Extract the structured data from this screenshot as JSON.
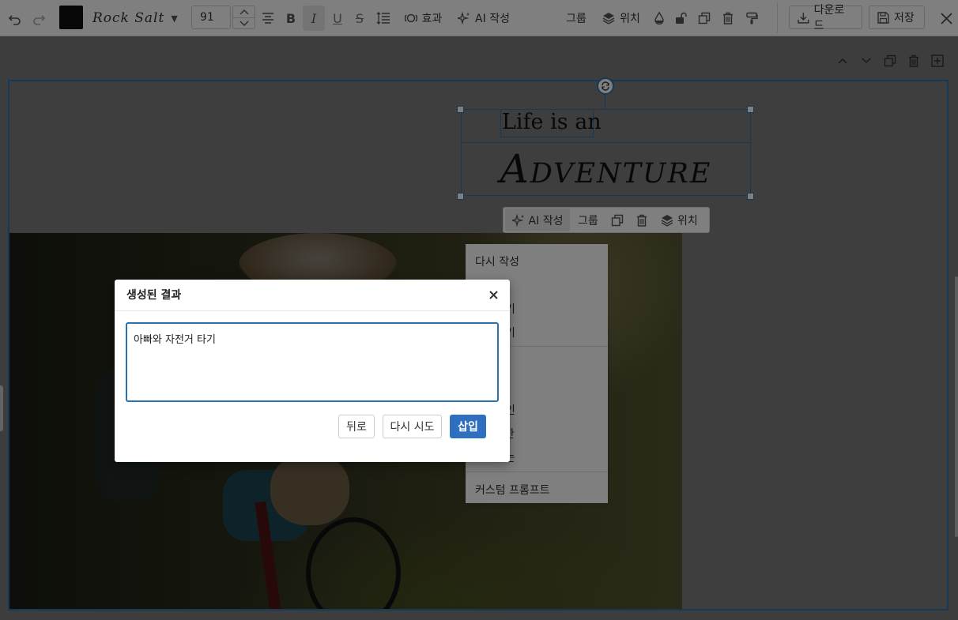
{
  "toolbar": {
    "font_color": "#111111",
    "font_name": "Rock Salt",
    "font_size": "91",
    "effects_label": "효과",
    "ai_write_label": "AI 작성",
    "group_label": "그룹",
    "position_label": "위치",
    "download_label": "다운로드",
    "save_label": "저장"
  },
  "canvas": {
    "title_line1": "Life is an",
    "title_line2": "Adventure"
  },
  "context_toolbar": {
    "ai_write_label": "AI 작성",
    "group_label": "그룹",
    "position_label": "위치"
  },
  "menu": {
    "items": [
      "다시 작성",
      "기",
      "기",
      "인",
      "소한",
      "는"
    ],
    "custom_prompt_label": "커스텀 프롬프트"
  },
  "modal": {
    "title": "생성된 결과",
    "result_text": "아빠와 자전거 타기",
    "back_label": "뒤로",
    "retry_label": "다시 시도",
    "insert_label": "삽입"
  },
  "colors": {
    "accent": "#2f6fc0",
    "selection": "#2b73ad"
  }
}
